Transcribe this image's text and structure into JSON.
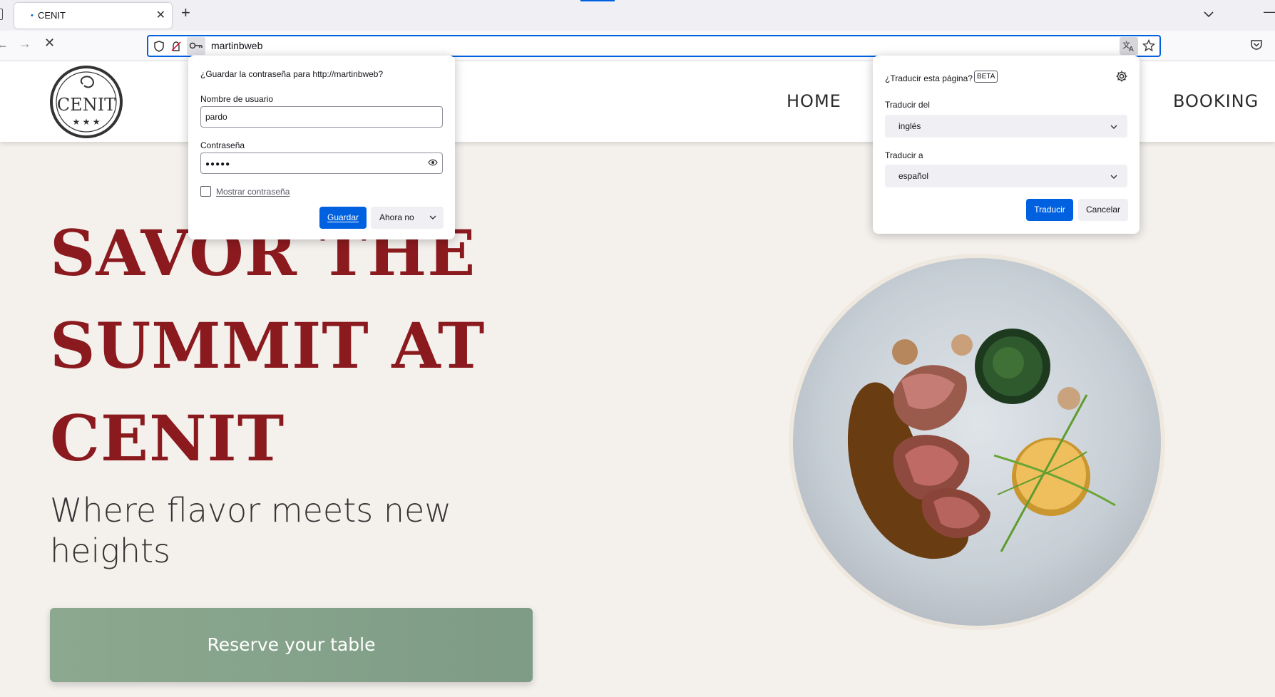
{
  "browser": {
    "tab": {
      "title": "CENIT",
      "loading_dot": "•"
    },
    "url": "martinbweb",
    "icons": [
      "sidebar-icon",
      "close-icon",
      "plus-icon",
      "chevron-down-icon",
      "minimize-icon",
      "back-icon",
      "forward-icon",
      "stop-icon",
      "shield-icon",
      "blocked-permission-icon",
      "key-icon",
      "translate-icon",
      "star-icon",
      "pocket-icon"
    ],
    "accent": "#0061e0"
  },
  "site": {
    "nav": {
      "home": "HOME",
      "booking": "BOOKING"
    },
    "logo_text": "CENIT",
    "hero_lines": [
      "SAVOR THE",
      "SUMMIT AT",
      "CENIT"
    ],
    "tagline": "Where flavor meets new heights",
    "cta": "Reserve your table",
    "colors": {
      "title": "#8b1a1f",
      "cta": "#8ca98f",
      "page_bg": "#f4f1ed"
    }
  },
  "password_popup": {
    "question": "¿Guardar la contraseña para http://martinbweb?",
    "username_label": "Nombre de usuario",
    "username_value": "pardo",
    "password_label": "Contraseña",
    "password_value": "●●●●●",
    "show_password_label": "Mostrar contraseña",
    "save_button": "Guardar",
    "not_now_button": "Ahora no"
  },
  "translate_popup": {
    "question": "¿Traducir esta página?",
    "badge": "BETA",
    "from_label": "Traducir del",
    "from_value": "inglés",
    "to_label": "Traducir a",
    "to_value": "español",
    "translate_button": "Traducir",
    "cancel_button": "Cancelar"
  }
}
